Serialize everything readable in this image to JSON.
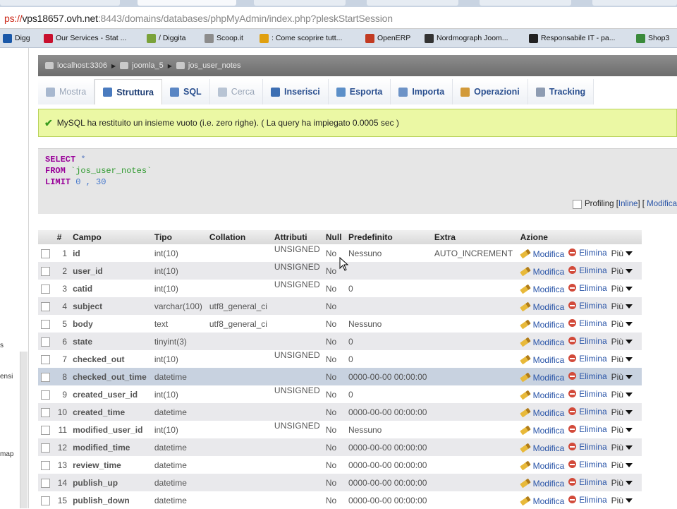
{
  "browser": {
    "url_proto": "ps://",
    "url_host": "vps18657.ovh.net",
    "url_rest": ":8443/domains/databases/phpMyAdmin/index.php?pleskStartSession"
  },
  "bookmarks": [
    {
      "label": "Digg",
      "icon": "digg-icon",
      "color": "#1a58a8"
    },
    {
      "label": "Our Services - Stat ...",
      "icon": "services-icon",
      "color": "#c8102e"
    },
    {
      "label": "/ Diggita",
      "icon": "diggita-icon",
      "color": "#7aa23a"
    },
    {
      "label": "Scoop.it",
      "icon": "scoopit-icon",
      "color": "#8c8c8c"
    },
    {
      "label": ": Come scoprire tutt...",
      "icon": "tips-icon",
      "color": "#e0a010"
    },
    {
      "label": "OpenERP",
      "icon": "openerp-icon",
      "color": "#c23b22"
    },
    {
      "label": "Nordmograph Joom...",
      "icon": "nordmograph-icon",
      "color": "#333333"
    },
    {
      "label": "Responsabile IT - pa...",
      "icon": "responsabile-icon",
      "color": "#222222"
    },
    {
      "label": "Shop3",
      "icon": "shop-icon",
      "color": "#3a8a3a"
    }
  ],
  "leftnav": {
    "fragments": [
      "s",
      "ensi",
      "map"
    ]
  },
  "breadcrumb": [
    "localhost:3306",
    "joomla_5",
    "jos_user_notes"
  ],
  "tabs": [
    {
      "label": "Mostra",
      "state": "disabled",
      "icon": "browse-icon"
    },
    {
      "label": "Struttura",
      "state": "active",
      "icon": "structure-icon"
    },
    {
      "label": "SQL",
      "state": "normal",
      "icon": "sql-icon"
    },
    {
      "label": "Cerca",
      "state": "disabled",
      "icon": "search-icon"
    },
    {
      "label": "Inserisci",
      "state": "normal",
      "icon": "insert-icon"
    },
    {
      "label": "Esporta",
      "state": "normal",
      "icon": "export-icon"
    },
    {
      "label": "Importa",
      "state": "normal",
      "icon": "import-icon"
    },
    {
      "label": "Operazioni",
      "state": "normal",
      "icon": "operations-icon"
    },
    {
      "label": "Tracking",
      "state": "normal",
      "icon": "tracking-icon"
    }
  ],
  "success_message": "MySQL ha restituito un insieme vuoto (i.e. zero righe). ( La query ha impiegato 0.0005 sec )",
  "sql": {
    "line1_kw": "SELECT",
    "line1_rest": " *",
    "line2_kw": "FROM",
    "line2_rest": " `jos_user_notes`",
    "line3_kw": "LIMIT",
    "line3_rest": " 0 , 30"
  },
  "profiling": {
    "label": "Profiling",
    "inline": "Inline",
    "edit": "Modifica"
  },
  "table": {
    "headers": [
      "",
      "#",
      "Campo",
      "Tipo",
      "Collation",
      "Attributi",
      "Null",
      "Predefinito",
      "Extra",
      "Azione"
    ],
    "action_edit": "Modifica",
    "action_delete": "Elimina",
    "action_more": "Più",
    "rows": [
      {
        "n": "1",
        "name": "id",
        "type": "int(10)",
        "collation": "",
        "attr": "UNSIGNED",
        "null": "No",
        "default": "Nessuno",
        "extra": "AUTO_INCREMENT"
      },
      {
        "n": "2",
        "name": "user_id",
        "type": "int(10)",
        "collation": "",
        "attr": "UNSIGNED",
        "null": "No",
        "default": "",
        "extra": ""
      },
      {
        "n": "3",
        "name": "catid",
        "type": "int(10)",
        "collation": "",
        "attr": "UNSIGNED",
        "null": "No",
        "default": "0",
        "extra": ""
      },
      {
        "n": "4",
        "name": "subject",
        "type": "varchar(100)",
        "collation": "utf8_general_ci",
        "attr": "",
        "null": "No",
        "default": "",
        "extra": ""
      },
      {
        "n": "5",
        "name": "body",
        "type": "text",
        "collation": "utf8_general_ci",
        "attr": "",
        "null": "No",
        "default": "Nessuno",
        "extra": ""
      },
      {
        "n": "6",
        "name": "state",
        "type": "tinyint(3)",
        "collation": "",
        "attr": "",
        "null": "No",
        "default": "0",
        "extra": ""
      },
      {
        "n": "7",
        "name": "checked_out",
        "type": "int(10)",
        "collation": "",
        "attr": "UNSIGNED",
        "null": "No",
        "default": "0",
        "extra": ""
      },
      {
        "n": "8",
        "name": "checked_out_time",
        "type": "datetime",
        "collation": "",
        "attr": "",
        "null": "No",
        "default": "0000-00-00 00:00:00",
        "extra": "",
        "selected": true
      },
      {
        "n": "9",
        "name": "created_user_id",
        "type": "int(10)",
        "collation": "",
        "attr": "UNSIGNED",
        "null": "No",
        "default": "0",
        "extra": ""
      },
      {
        "n": "10",
        "name": "created_time",
        "type": "datetime",
        "collation": "",
        "attr": "",
        "null": "No",
        "default": "0000-00-00 00:00:00",
        "extra": ""
      },
      {
        "n": "11",
        "name": "modified_user_id",
        "type": "int(10)",
        "collation": "",
        "attr": "UNSIGNED",
        "null": "No",
        "default": "Nessuno",
        "extra": ""
      },
      {
        "n": "12",
        "name": "modified_time",
        "type": "datetime",
        "collation": "",
        "attr": "",
        "null": "No",
        "default": "0000-00-00 00:00:00",
        "extra": ""
      },
      {
        "n": "13",
        "name": "review_time",
        "type": "datetime",
        "collation": "",
        "attr": "",
        "null": "No",
        "default": "0000-00-00 00:00:00",
        "extra": ""
      },
      {
        "n": "14",
        "name": "publish_up",
        "type": "datetime",
        "collation": "",
        "attr": "",
        "null": "No",
        "default": "0000-00-00 00:00:00",
        "extra": ""
      },
      {
        "n": "15",
        "name": "publish_down",
        "type": "datetime",
        "collation": "",
        "attr": "",
        "null": "No",
        "default": "0000-00-00 00:00:00",
        "extra": ""
      }
    ]
  }
}
